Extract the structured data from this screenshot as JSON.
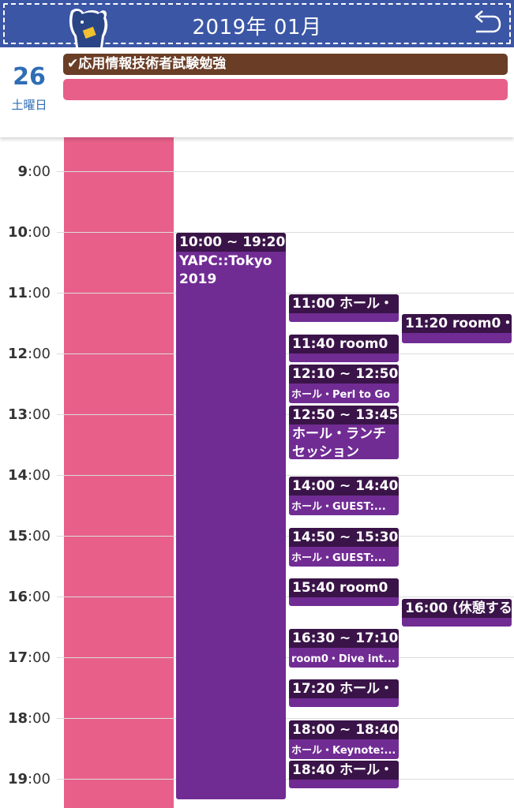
{
  "header": {
    "title": "2019年 01月",
    "background_color": "#3b56a5",
    "mascot_icon": "bear-mascot-icon",
    "back_icon": "undo-arrow-icon"
  },
  "day": {
    "number": "26",
    "weekday": "土曜日",
    "color": "#2f6db5"
  },
  "all_day_events": [
    {
      "label": "✔応用情報技術者試験勉強",
      "color": "#6a3d26"
    },
    {
      "label": "",
      "color": "#e8608a"
    }
  ],
  "hours": [
    "9",
    "10",
    "11",
    "12",
    "13",
    "14",
    "15",
    "16",
    "17",
    "18",
    "19"
  ],
  "hour_suffix": ":00",
  "events": [
    {
      "head": "10:00 ~ 19:20",
      "body": "YAPC::Tokyo 2019"
    },
    {
      "head": "11:00  ホール・"
    },
    {
      "head": "11:20  room0・"
    },
    {
      "head": "11:40  room0"
    },
    {
      "head": "12:10 ~ 12:50",
      "sub": "ホール・Perl to Go"
    },
    {
      "head": "12:50 ~ 13:45",
      "body": "ホール・ランチセッション"
    },
    {
      "head": "14:00 ~ 14:40",
      "sub": "ホール・GUEST:..."
    },
    {
      "head": "14:50 ~ 15:30",
      "sub": "ホール・GUEST:..."
    },
    {
      "head": "15:40  room0"
    },
    {
      "head": "16:00  (休憩する"
    },
    {
      "head": "16:30 ~ 17:10",
      "sub": "room0・Dive int..."
    },
    {
      "head": "17:20  ホール・"
    },
    {
      "head": "18:00 ~ 18:40",
      "sub": "ホール・Keynote:..."
    },
    {
      "head": "18:40  ホール・"
    }
  ],
  "colors": {
    "pink": "#e8608a",
    "purple": "#712c94",
    "purple_dark": "#3a1448"
  }
}
